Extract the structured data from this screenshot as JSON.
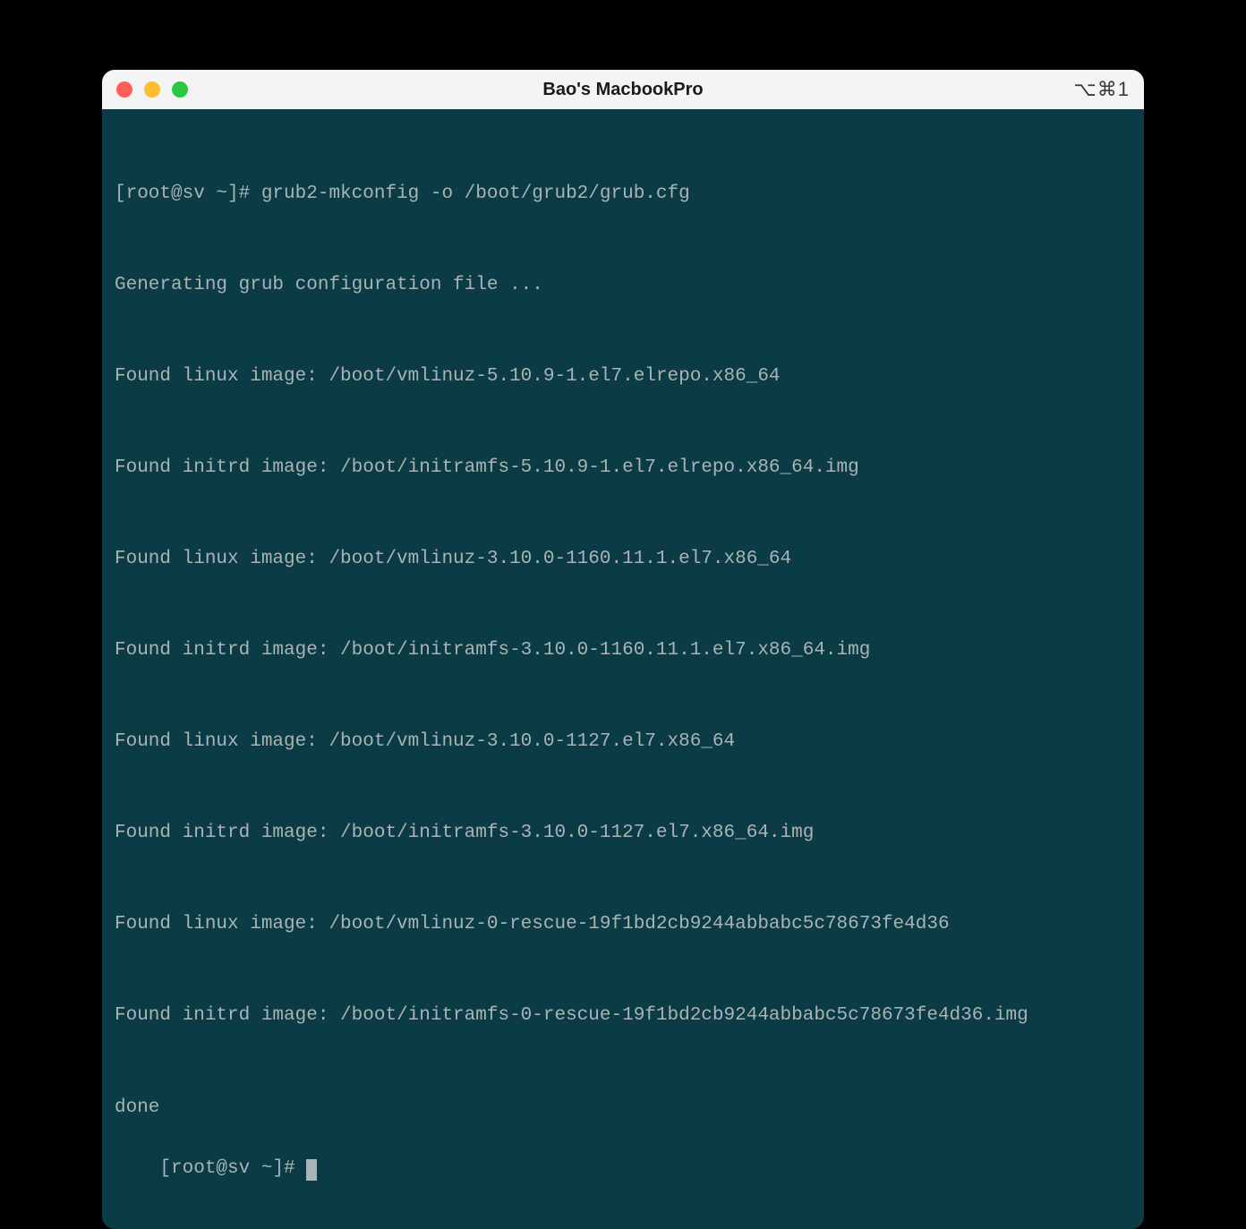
{
  "window": {
    "title": "Bao's MacbookPro",
    "shortcut": "⌥⌘1"
  },
  "terminal": {
    "prompt1": "[root@sv ~]# grub2-mkconfig -o /boot/grub2/grub.cfg",
    "lines": [
      "Generating grub configuration file ...",
      "Found linux image: /boot/vmlinuz-5.10.9-1.el7.elrepo.x86_64",
      "Found initrd image: /boot/initramfs-5.10.9-1.el7.elrepo.x86_64.img",
      "Found linux image: /boot/vmlinuz-3.10.0-1160.11.1.el7.x86_64",
      "Found initrd image: /boot/initramfs-3.10.0-1160.11.1.el7.x86_64.img",
      "Found linux image: /boot/vmlinuz-3.10.0-1127.el7.x86_64",
      "Found initrd image: /boot/initramfs-3.10.0-1127.el7.x86_64.img",
      "Found linux image: /boot/vmlinuz-0-rescue-19f1bd2cb9244abbabc5c78673fe4d36",
      "Found initrd image: /boot/initramfs-0-rescue-19f1bd2cb9244abbabc5c78673fe4d36.img",
      "done"
    ],
    "prompt2": "[root@sv ~]# "
  }
}
